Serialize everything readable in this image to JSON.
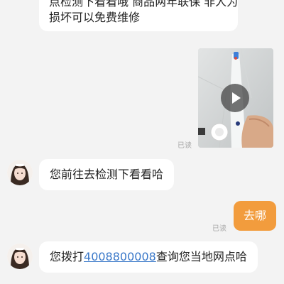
{
  "messages": {
    "top_line1": "点检测下看看哦 商品两年联保 非人为",
    "top_line2": "损坏可以免费维修",
    "video_status": "已读",
    "msg2": "您前往去检测下看看哈",
    "mine": "去哪",
    "mine_status": "已读",
    "msg3_prefix": "您拨打",
    "msg3_phone": "4008800008",
    "msg3_suffix": "查询您当地网点哈"
  },
  "colors": {
    "background": "#f3f3f3",
    "my_bubble": "#f29c3d",
    "link": "#3a78c9"
  }
}
